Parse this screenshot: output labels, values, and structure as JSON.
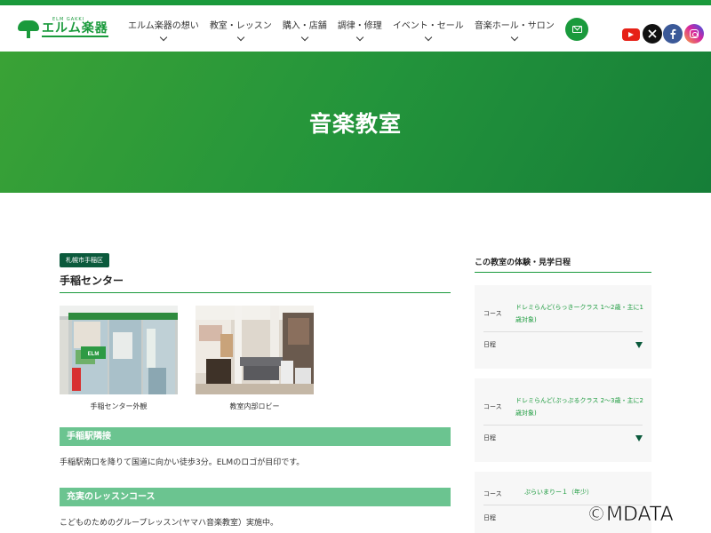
{
  "header": {
    "logo_text": "エルム楽器",
    "logo_sub": "ELM GAKKI",
    "nav": [
      {
        "label": "エルム楽器の想い"
      },
      {
        "label": "教室・レッスン"
      },
      {
        "label": "購入・店舗"
      },
      {
        "label": "調律・修理"
      },
      {
        "label": "イベント・セール"
      },
      {
        "label": "音楽ホール・サロン"
      }
    ]
  },
  "hero": {
    "title": "音楽教室"
  },
  "main": {
    "area_tag": "札幌市手稲区",
    "school_name": "手稲センター",
    "photos": [
      {
        "caption": "手稲センター外観",
        "sign": "ELM"
      },
      {
        "caption": "教室内部ロビー"
      }
    ],
    "sections": [
      {
        "heading": "手稲駅隣接",
        "text": "手稲駅南口を降りて国道に向かい徒歩3分。ELMのロゴが目印です。"
      },
      {
        "heading": "充実のレッスンコース",
        "text": "こどものためのグループレッスン(ヤマハ音楽教室）実施中。"
      }
    ]
  },
  "sidebar": {
    "title": "この教室の体験・見学日程",
    "course_label": "コース",
    "schedule_label": "日程",
    "cards": [
      {
        "course": "ドレミらんど(らっきークラス 1～2歳・主に1歳対象)"
      },
      {
        "course": "ドレミらんど(ぷっぷるクラス 2～3歳・主に2歳対象)"
      },
      {
        "course": "ぷらいまりー１（年少）"
      }
    ]
  },
  "watermark": "©MDATA",
  "colors": {
    "brand_green": "#1a9a3c",
    "dark_green": "#0b5a3c",
    "section_green": "#6bc490"
  }
}
